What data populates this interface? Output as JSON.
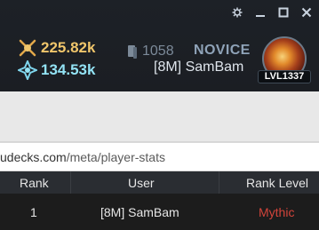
{
  "window": {
    "controls": [
      {
        "name": "settings",
        "icon": "gear-icon"
      },
      {
        "name": "minimize",
        "icon": "minimize-icon"
      },
      {
        "name": "maximize",
        "icon": "maximize-icon"
      },
      {
        "name": "close",
        "icon": "close-icon"
      }
    ]
  },
  "header": {
    "gold": {
      "value": "225.82k",
      "icon": "gold-icon",
      "color": "#f0c66b"
    },
    "gems": {
      "value": "134.53k",
      "icon": "gem-icon",
      "color": "#93e3f5"
    },
    "cards": {
      "count": "1058",
      "icon": "card-icon"
    },
    "rank": "NOVICE",
    "username": "[8M] SamBam",
    "level": "LVL1337"
  },
  "browser": {
    "url_host": "udecks.com",
    "url_path": "/meta/player-stats"
  },
  "table": {
    "headers": [
      "Rank",
      "User",
      "Rank Level"
    ],
    "rows": [
      {
        "rank": "1",
        "user": "[8M] SamBam",
        "rank_level": "Mythic",
        "rank_level_color": "#d2443a"
      }
    ]
  }
}
